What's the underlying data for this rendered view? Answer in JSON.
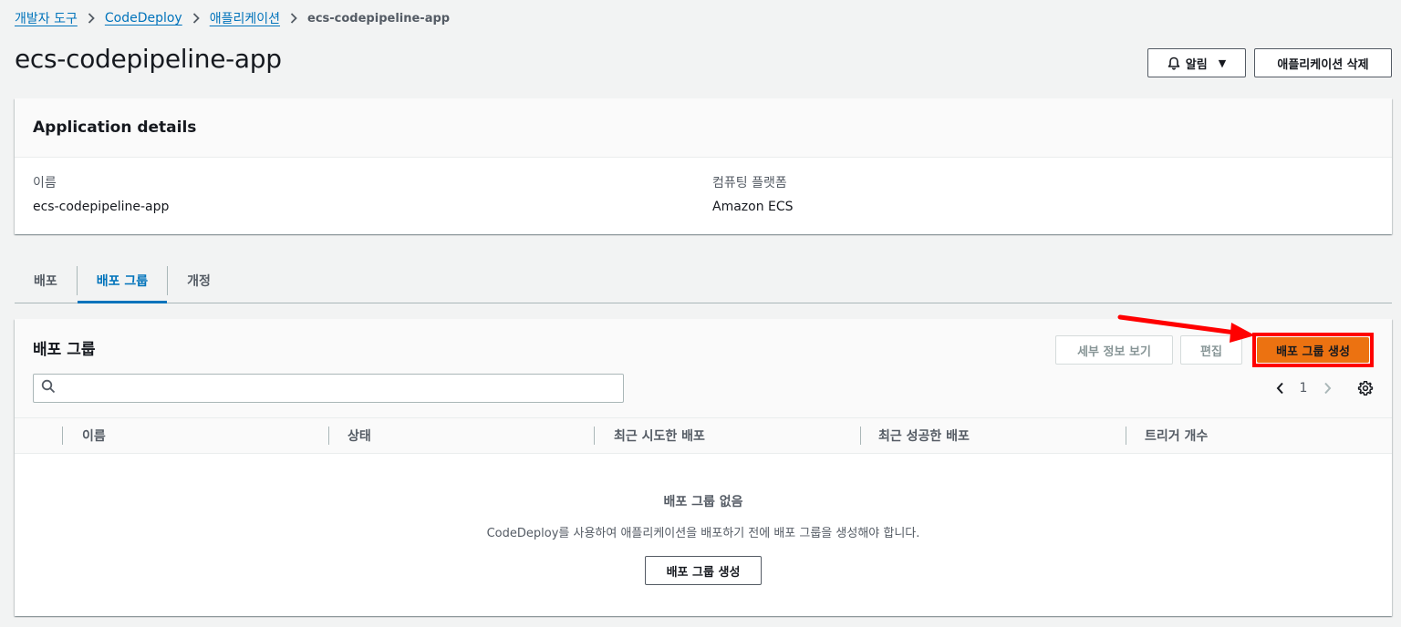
{
  "breadcrumb": {
    "items": [
      "개발자 도구",
      "CodeDeploy",
      "애플리케이션"
    ],
    "current": "ecs-codepipeline-app"
  },
  "header": {
    "title": "ecs-codepipeline-app",
    "notify_label": "알림",
    "delete_label": "애플리케이션 삭제"
  },
  "details": {
    "title": "Application details",
    "name_label": "이름",
    "name_value": "ecs-codepipeline-app",
    "platform_label": "컴퓨팅 플랫폼",
    "platform_value": "Amazon ECS"
  },
  "tabs": [
    {
      "label": "배포",
      "active": false
    },
    {
      "label": "배포 그룹",
      "active": true
    },
    {
      "label": "개정",
      "active": false
    }
  ],
  "groups": {
    "title": "배포 그룹",
    "view_details_label": "세부 정보 보기",
    "edit_label": "편집",
    "create_label": "배포 그룹 생성",
    "search": {
      "value": "",
      "placeholder": ""
    },
    "page": "1",
    "columns": [
      "이름",
      "상태",
      "최근 시도한 배포",
      "최근 성공한 배포",
      "트리거 개수"
    ],
    "rows": [],
    "empty_title": "배포 그룹 없음",
    "empty_description": "CodeDeploy를 사용하여 애플리케이션을 배포하기 전에 배포 그룹을 생성해야 합니다.",
    "empty_create_label": "배포 그룹 생성"
  },
  "colors": {
    "link": "#0073bb",
    "primary": "#ec7211",
    "annotation": "#ff0000"
  }
}
